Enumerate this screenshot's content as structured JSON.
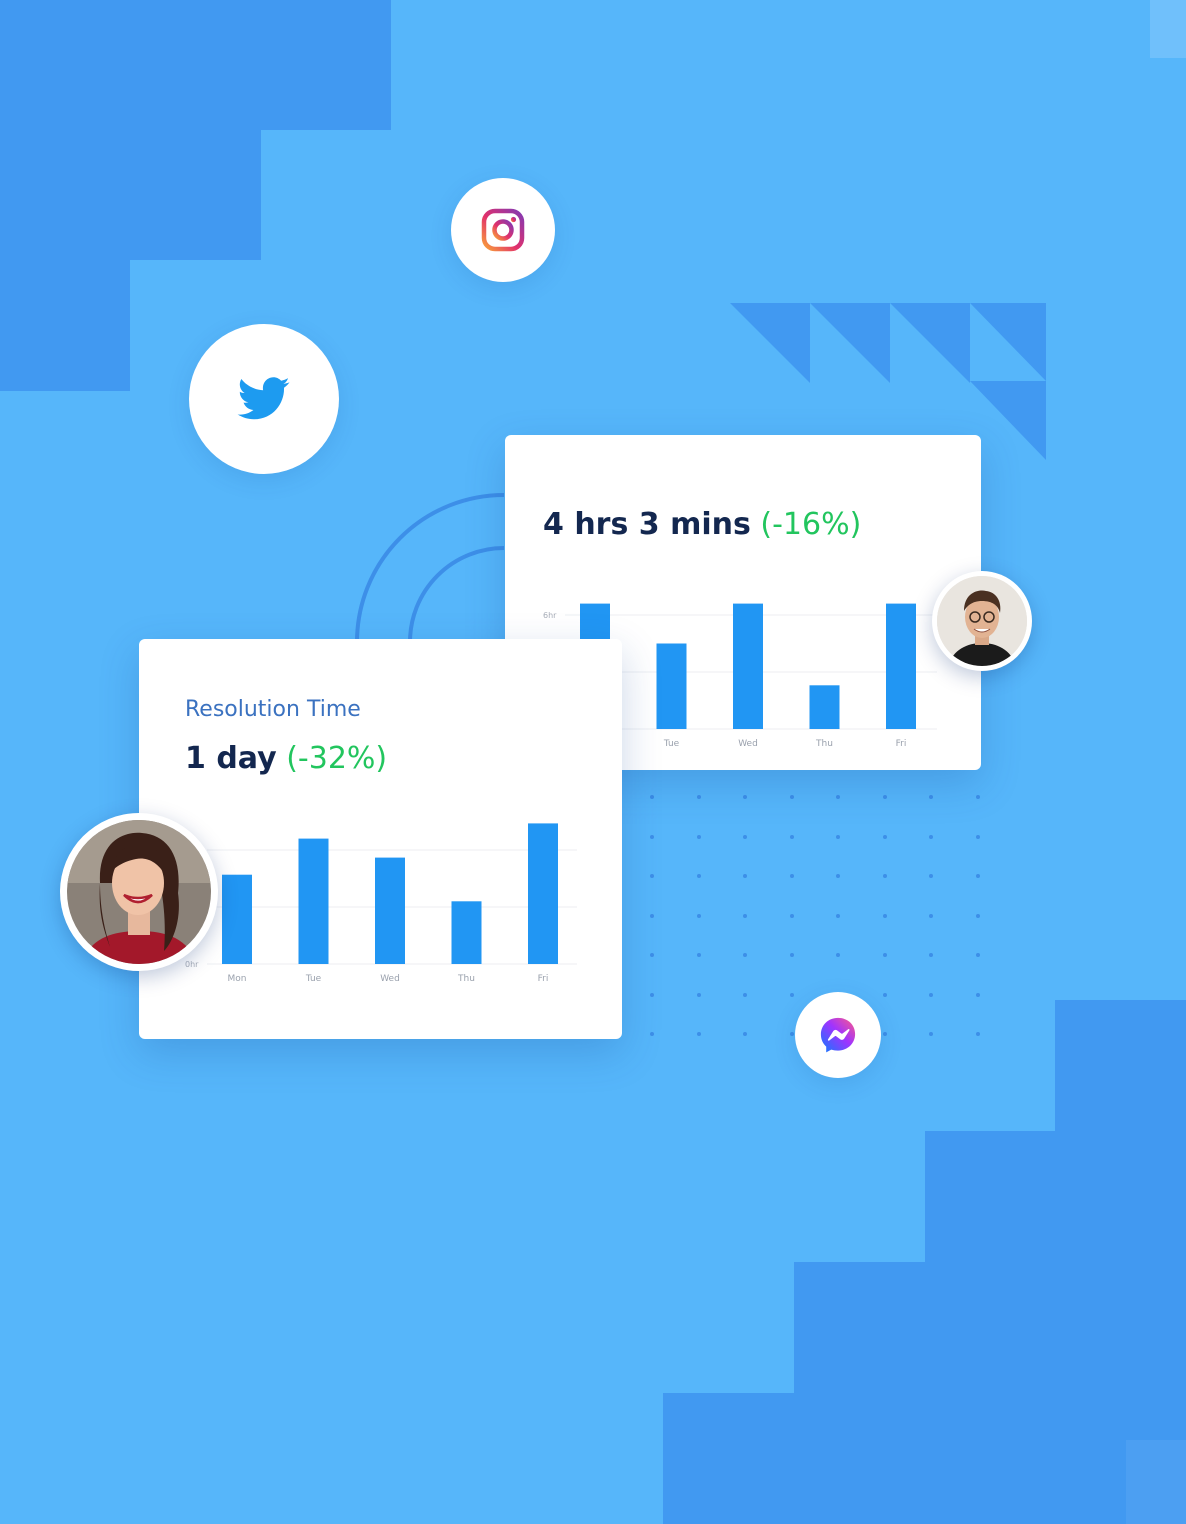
{
  "colors": {
    "background": "#56b6fa",
    "decoration": "#4199f1",
    "bar": "#2196f3",
    "metric_text": "#13274f",
    "title_text": "#3b72c0",
    "change_text": "#22c55e"
  },
  "icons": {
    "instagram": "instagram-icon",
    "twitter": "twitter-icon",
    "messenger": "messenger-icon"
  },
  "card_front": {
    "title": "Resolution Time",
    "metric": "1 day",
    "change": "(-32%)"
  },
  "card_back": {
    "metric": "4 hrs 3 mins",
    "change": "(-16%)"
  },
  "chart_data": [
    {
      "type": "bar",
      "categories": [
        "Mon",
        "Tue",
        "Wed",
        "Thu",
        "Fri"
      ],
      "values": [
        6.6,
        4.5,
        6.6,
        2.3,
        6.6
      ],
      "y_ticks": [
        "0hr",
        "3hr",
        "6hr"
      ],
      "ylim": [
        0,
        6
      ],
      "grid": true
    },
    {
      "type": "bar",
      "categories": [
        "Mon",
        "Tue",
        "Wed",
        "Thu",
        "Fri"
      ],
      "values": [
        4.7,
        6.6,
        5.6,
        3.3,
        7.4
      ],
      "y_ticks": [
        "0hr"
      ],
      "ylim": [
        0,
        6
      ],
      "grid": true
    }
  ]
}
